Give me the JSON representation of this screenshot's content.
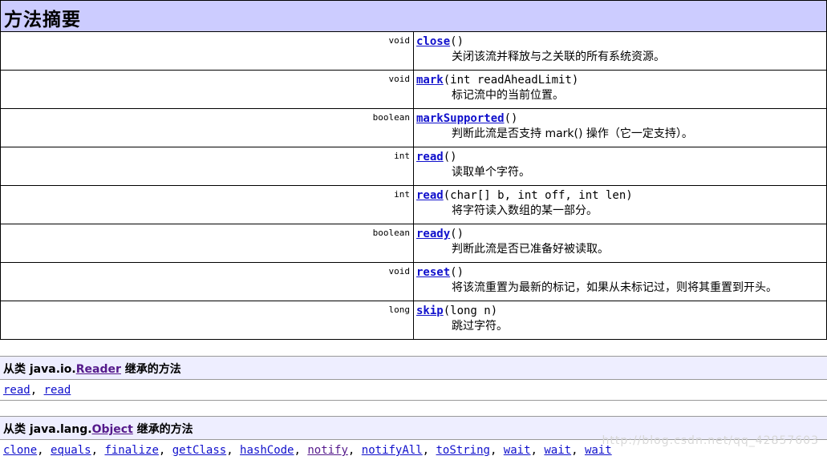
{
  "summary": {
    "title": "方法摘要",
    "methods": [
      {
        "type": "void",
        "name": "close",
        "params": "()",
        "desc": "关闭该流并释放与之关联的所有系统资源。"
      },
      {
        "type": "void",
        "name": "mark",
        "params": "(int readAheadLimit)",
        "desc": "标记流中的当前位置。"
      },
      {
        "type": "boolean",
        "name": "markSupported",
        "params": "()",
        "desc": "判断此流是否支持 mark() 操作（它一定支持）。"
      },
      {
        "type": "int",
        "name": "read",
        "params": "()",
        "desc": "读取单个字符。"
      },
      {
        "type": "int",
        "name": "read",
        "params": "(char[] b, int off, int len)",
        "desc": "将字符读入数组的某一部分。"
      },
      {
        "type": "boolean",
        "name": "ready",
        "params": "()",
        "desc": "判断此流是否已准备好被读取。"
      },
      {
        "type": "void",
        "name": "reset",
        "params": "()",
        "desc": "将该流重置为最新的标记，如果从未标记过，则将其重置到开头。"
      },
      {
        "type": "long",
        "name": "skip",
        "params": "(long n)",
        "desc": "跳过字符。"
      }
    ]
  },
  "inherited_reader": {
    "prefix": "从类 java.io.",
    "class_link": "Reader",
    "suffix": " 继承的方法",
    "methods": [
      "read",
      "read"
    ]
  },
  "inherited_object": {
    "prefix": "从类 java.lang.",
    "class_link": "Object",
    "suffix": " 继承的方法",
    "methods": [
      "clone",
      "equals",
      "finalize",
      "getClass",
      "hashCode",
      "notify",
      "notifyAll",
      "toString",
      "wait",
      "wait",
      "wait"
    ]
  },
  "watermark": "http://blog.csdn.net/qq_42857603"
}
